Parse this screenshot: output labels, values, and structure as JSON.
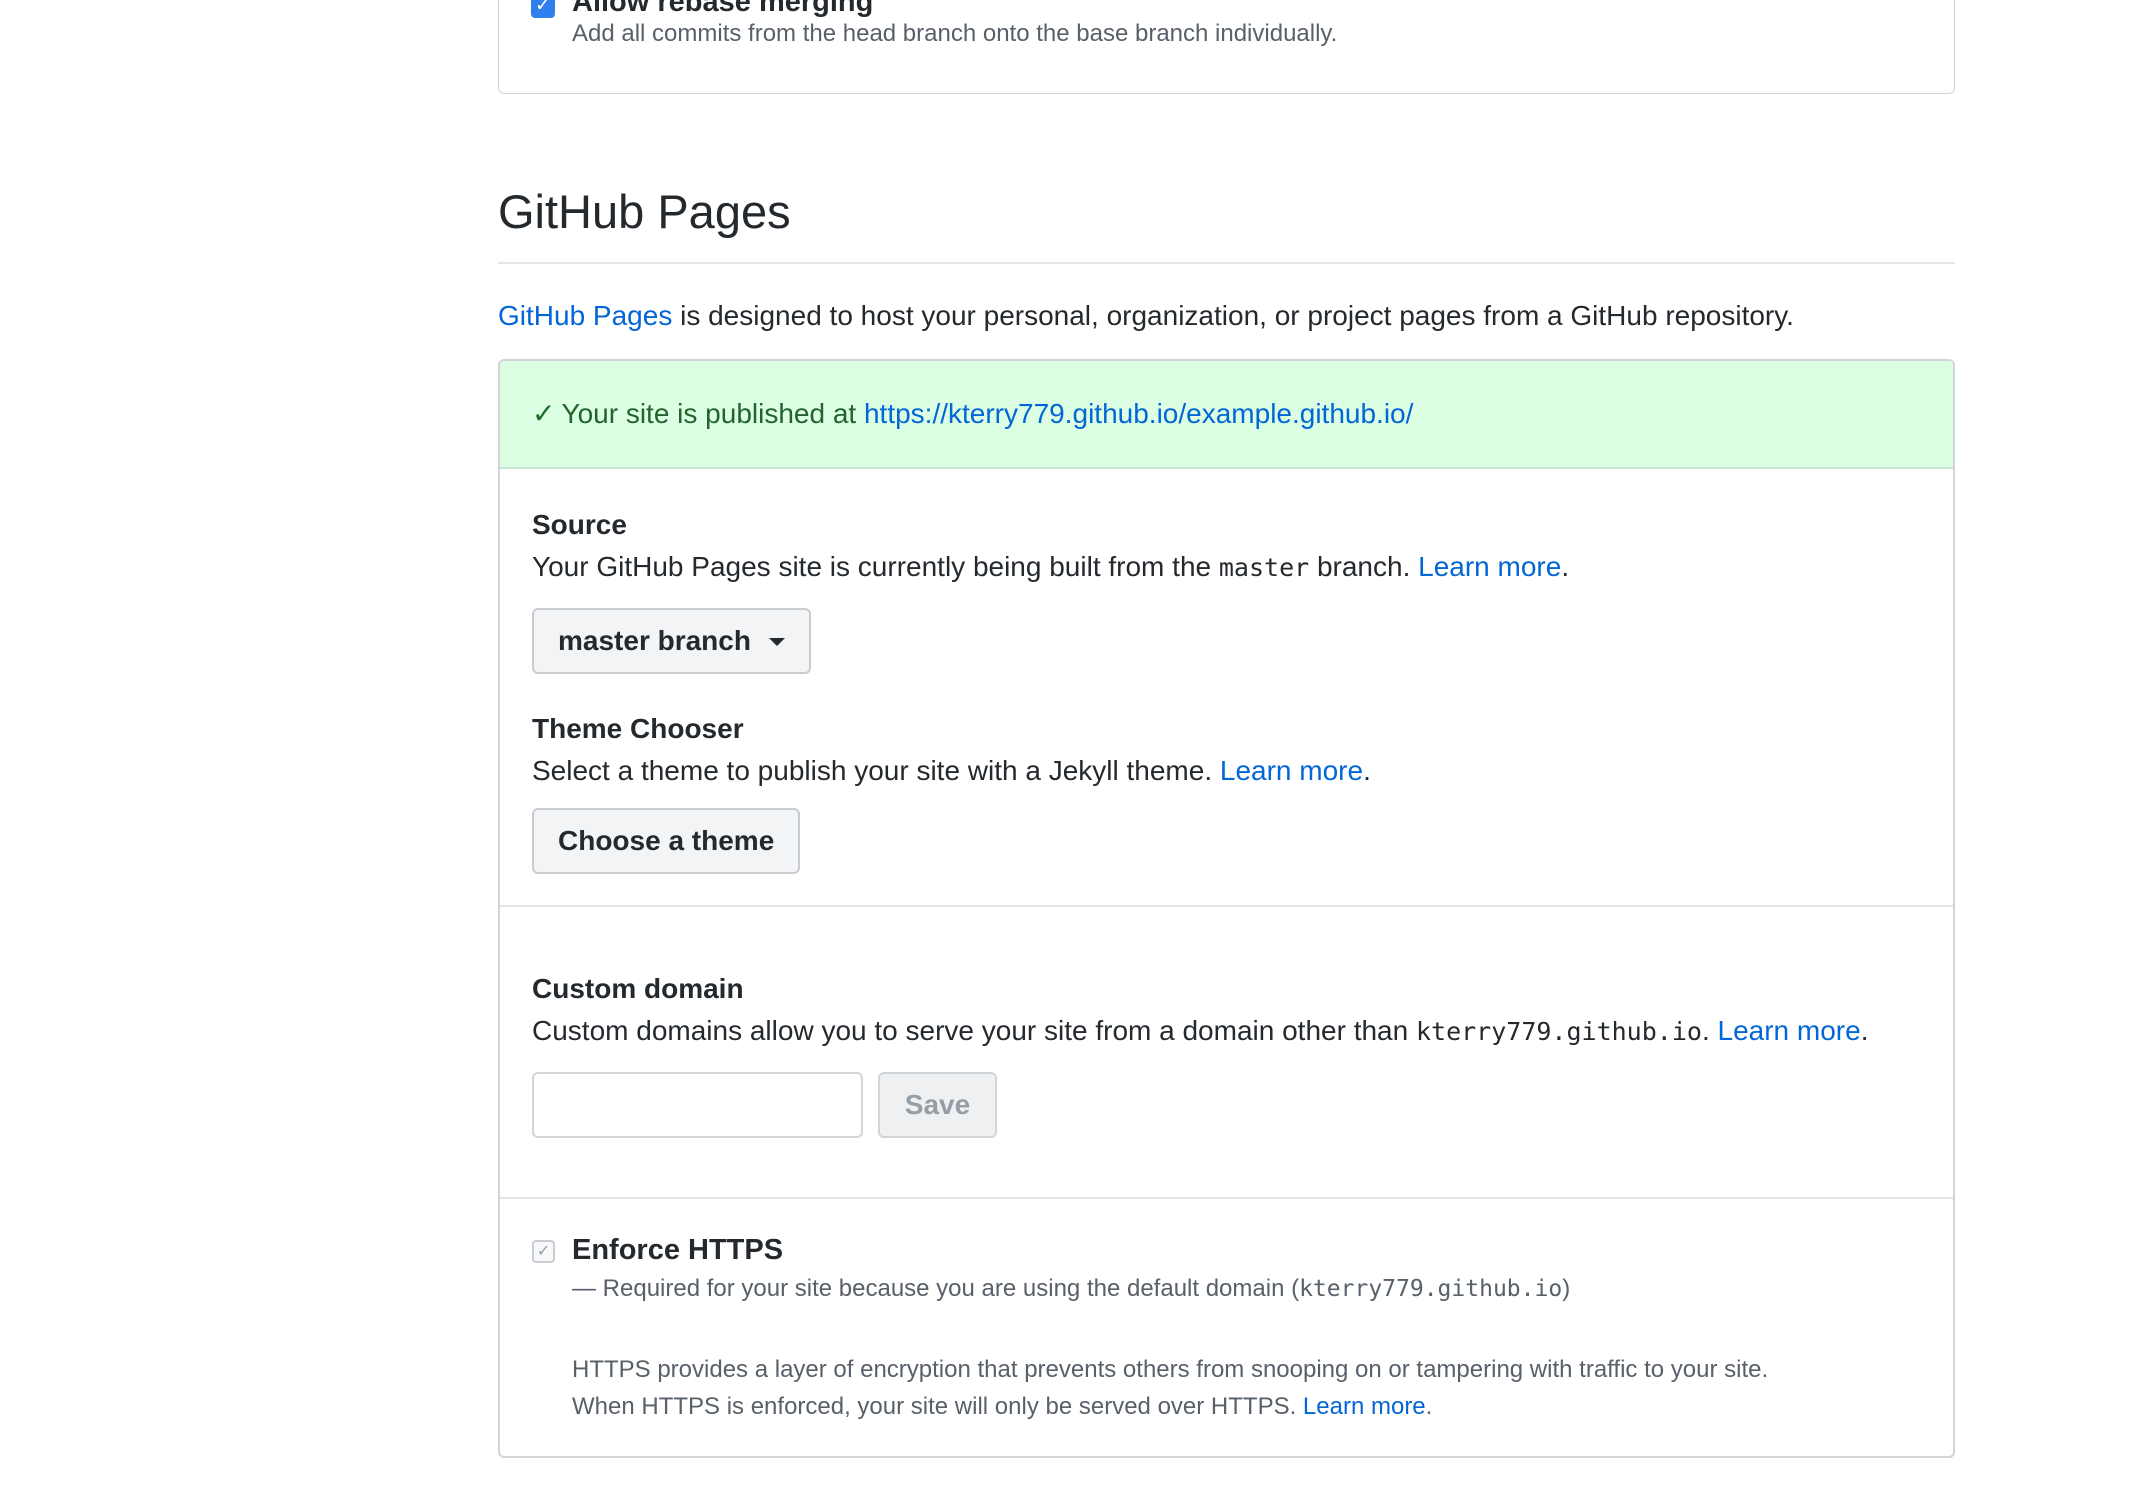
{
  "merge": {
    "title": "Allow rebase merging",
    "description": "Add all commits from the head branch onto the base branch individually."
  },
  "pages": {
    "heading": "GitHub Pages",
    "intro_link": "GitHub Pages",
    "intro_text": " is designed to host your personal, organization, or project pages from a GitHub repository.",
    "published_text": "Your site is published at ",
    "published_url": "https://kterry779.github.io/example.github.io/",
    "source": {
      "label": "Source",
      "desc_before": "Your GitHub Pages site is currently being built from the ",
      "branch_code": "master",
      "desc_after": " branch. ",
      "learn_more": "Learn more",
      "dropdown_label": "master branch"
    },
    "theme": {
      "label": "Theme Chooser",
      "desc": "Select a theme to publish your site with a Jekyll theme. ",
      "learn_more": "Learn more",
      "button": "Choose a theme"
    },
    "custom_domain": {
      "label": "Custom domain",
      "desc": "Custom domains allow you to serve your site from a domain other than ",
      "domain_code": "kterry779.github.io",
      "learn_more": "Learn more",
      "input_value": "",
      "save": "Save"
    },
    "https": {
      "title": "Enforce HTTPS",
      "note_before": "— Required for your site because you are using the default domain (",
      "note_code": "kterry779.github.io",
      "note_after": ")",
      "desc_line1": "HTTPS provides a layer of encryption that prevents others from snooping on or tampering with traffic to your site.",
      "desc_line2": "When HTTPS is enforced, your site will only be served over HTTPS. ",
      "learn_more": "Learn more"
    }
  }
}
